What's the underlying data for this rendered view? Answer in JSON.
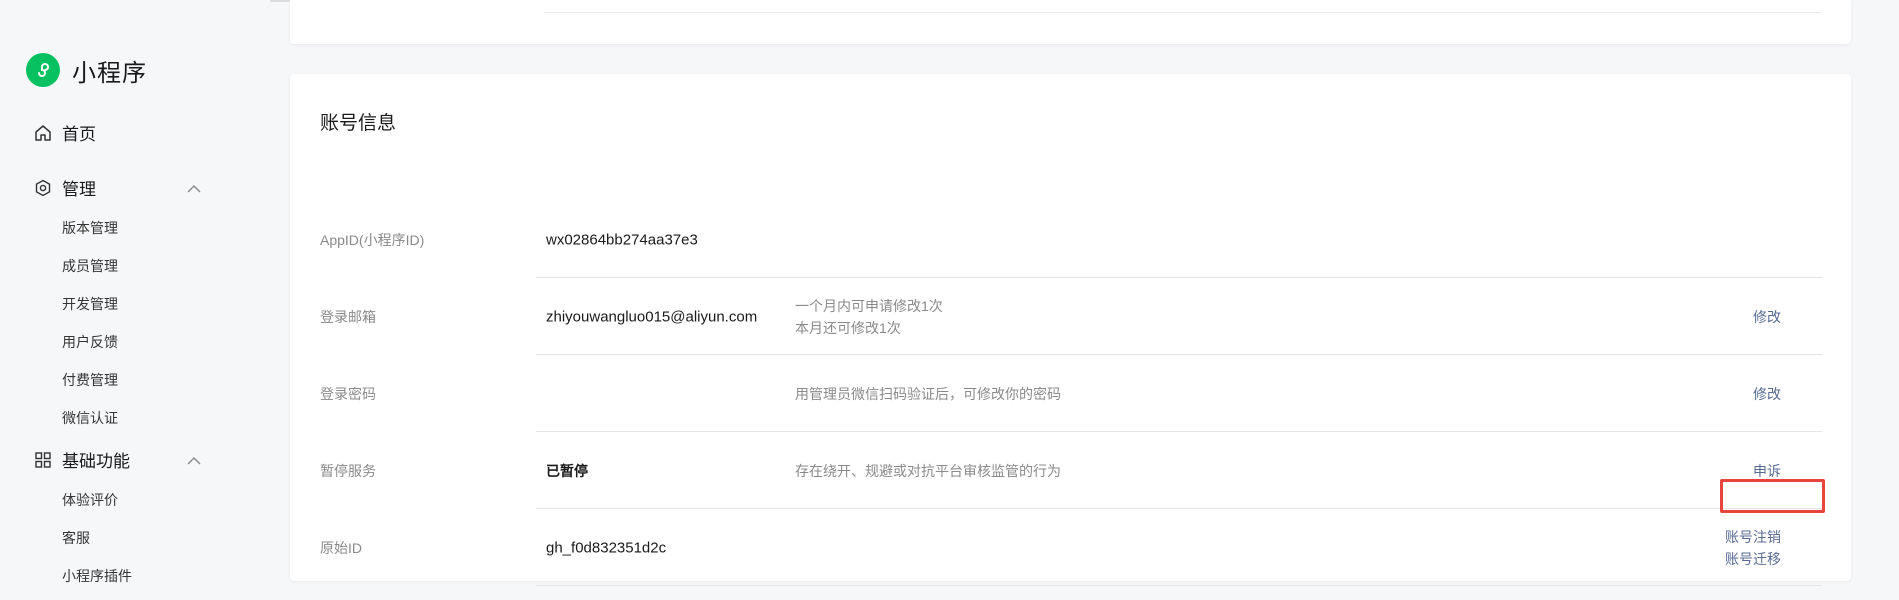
{
  "brand": {
    "name": "小程序",
    "logo_icon": "mini-program-logo-icon",
    "logo_color": "#07c160"
  },
  "sidebar": {
    "home": {
      "label": "首页",
      "icon": "home-icon"
    },
    "manage": {
      "label": "管理",
      "icon": "hexagon-settings-icon",
      "expanded": true,
      "items": [
        "版本管理",
        "成员管理",
        "开发管理",
        "用户反馈",
        "付费管理",
        "微信认证"
      ]
    },
    "basic": {
      "label": "基础功能",
      "icon": "grid-icon",
      "expanded": true,
      "items": [
        "体验评价",
        "客服",
        "小程序插件"
      ]
    }
  },
  "account": {
    "title": "账号信息",
    "rows": [
      {
        "label": "AppID(小程序ID)",
        "value": "wx02864bb274aa37e3"
      },
      {
        "label": "登录邮箱",
        "value": "zhiyouwangluo015@aliyun.com",
        "desc": [
          "一个月内可申请修改1次",
          "本月还可修改1次"
        ],
        "action": "修改"
      },
      {
        "label": "登录密码",
        "value": "",
        "desc": [
          "用管理员微信扫码验证后，可修改你的密码"
        ],
        "action": "修改"
      },
      {
        "label": "暂停服务",
        "value": "已暂停",
        "desc": [
          "存在绕开、规避或对抗平台审核监管的行为"
        ],
        "action": "申诉"
      },
      {
        "label": "原始ID",
        "value": "gh_f0d832351d2c",
        "actions": [
          "账号注销",
          "账号迁移"
        ]
      }
    ]
  },
  "colors": {
    "link": "#576b95",
    "highlight": "#e8453c"
  }
}
